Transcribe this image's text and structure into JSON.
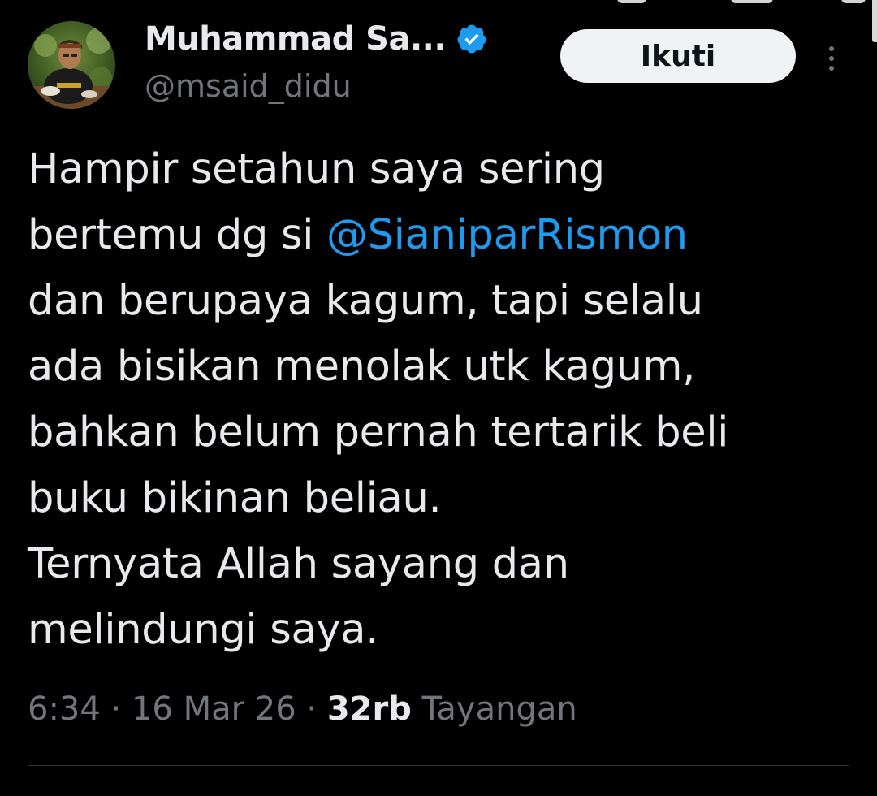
{
  "colors": {
    "background": "#000000",
    "text_primary": "#e7e9ea",
    "text_secondary": "#71767b",
    "link": "#1d9bf0",
    "verified": "#1d9bf0",
    "button_bg": "#eff3f4",
    "divider": "#2f3336"
  },
  "author": {
    "display_name": "Muhammad Sa...",
    "handle": "@msaid_didu",
    "verified_icon": "verified-badge-icon",
    "avatar_icon": "avatar"
  },
  "actions": {
    "follow_label": "Ikuti",
    "more_icon": "more-vertical-icon"
  },
  "tweet": {
    "line1": "Hampir setahun saya sering",
    "line2_prefix": "bertemu dg si ",
    "mention": "@SianiparRismon",
    "line3": "dan berupaya kagum, tapi selalu",
    "line4": "ada bisikan menolak utk kagum,",
    "line5": "bahkan belum pernah tertarik beli",
    "line6": "buku bikinan beliau.",
    "line7": "Ternyata Allah sayang dan",
    "line8": "melindungi saya."
  },
  "meta": {
    "time": "6:34",
    "separator": "·",
    "date": "16 Mar 26",
    "views_count": "32rb",
    "views_label": "Tayangan"
  }
}
